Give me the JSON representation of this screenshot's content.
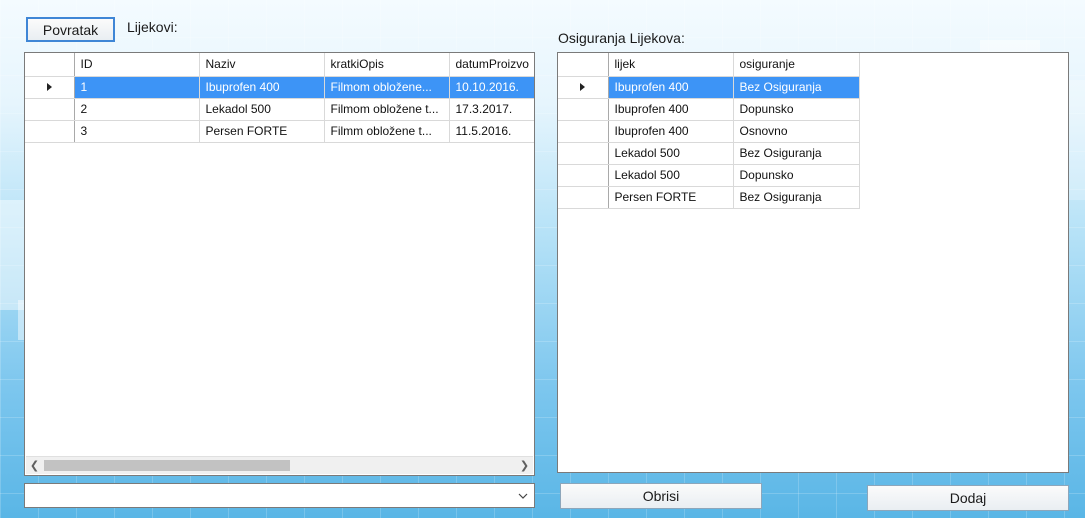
{
  "header": {
    "back_button_label": "Povratak",
    "lijekovi_label": "Lijekovi:",
    "osiguranja_label": "Osiguranja Lijekova:"
  },
  "lijekovi_grid": {
    "columns": [
      "ID",
      "Naziv",
      "kratkiOpis",
      "datumProizvo"
    ],
    "rows": [
      {
        "id": "1",
        "naziv": "Ibuprofen 400",
        "opis": "Filmom obložene...",
        "datum": "10.10.2016.",
        "selected": true
      },
      {
        "id": "2",
        "naziv": "Lekadol 500",
        "opis": "Filmom obložene t...",
        "datum": "17.3.2017.",
        "selected": false
      },
      {
        "id": "3",
        "naziv": "Persen FORTE",
        "opis": "Filmm obložene t...",
        "datum": "11.5.2016.",
        "selected": false
      }
    ]
  },
  "osiguranja_grid": {
    "columns": [
      "lijek",
      "osiguranje"
    ],
    "rows": [
      {
        "lijek": "Ibuprofen 400",
        "osiguranje": "Bez Osiguranja",
        "selected": true
      },
      {
        "lijek": "Ibuprofen 400",
        "osiguranje": "Dopunsko",
        "selected": false
      },
      {
        "lijek": "Ibuprofen 400",
        "osiguranje": "Osnovno",
        "selected": false
      },
      {
        "lijek": "Lekadol 500",
        "osiguranje": "Bez Osiguranja",
        "selected": false
      },
      {
        "lijek": "Lekadol 500",
        "osiguranje": "Dopunsko",
        "selected": false
      },
      {
        "lijek": "Persen FORTE",
        "osiguranje": "Bez Osiguranja",
        "selected": false
      }
    ]
  },
  "combo": {
    "value": ""
  },
  "buttons": {
    "obrisi_label": "Obrisi",
    "dodaj_label": "Dodaj"
  },
  "colors": {
    "selection": "#3d94f6",
    "focus_border": "#3f86d6"
  },
  "icons": {
    "row_indicator": "row-pointer-icon",
    "scroll_left": "chevron-left-icon",
    "scroll_right": "chevron-right-icon",
    "dropdown": "chevron-down-icon"
  }
}
